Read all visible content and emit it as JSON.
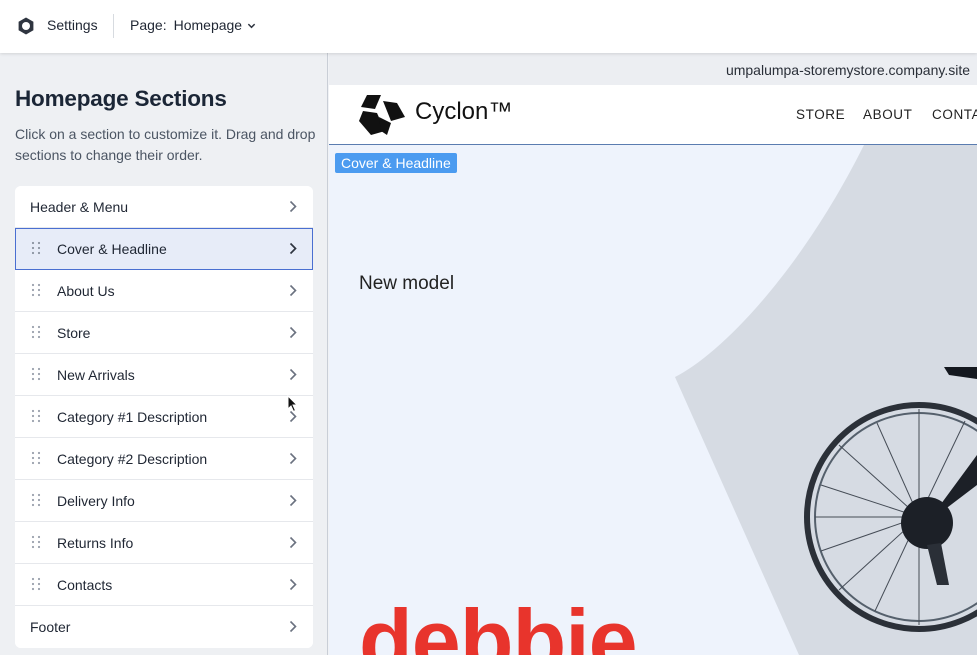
{
  "topbar": {
    "settings_label": "Settings",
    "page_label": "Page:",
    "page_value": "Homepage"
  },
  "sidebar": {
    "title": "Homepage Sections",
    "description": "Click on a section to customize it. Drag and drop sections to change their order.",
    "sections": [
      {
        "label": "Header & Menu"
      },
      {
        "label": "Cover & Headline",
        "selected": true
      },
      {
        "label": "About Us"
      },
      {
        "label": "Store"
      },
      {
        "label": "New Arrivals"
      },
      {
        "label": "Category #1 Description"
      },
      {
        "label": "Category #2 Description"
      },
      {
        "label": "Delivery Info"
      },
      {
        "label": "Returns Info"
      },
      {
        "label": "Contacts"
      },
      {
        "label": "Footer"
      }
    ]
  },
  "preview": {
    "url": "umpalumpa-storemystore.company.site",
    "brand": "Cyclon™",
    "nav": [
      "STORE",
      "ABOUT",
      "CONTA"
    ],
    "section_badge": "Cover & Headline",
    "cover_subtitle": "New model",
    "cover_word": "debbie"
  },
  "colors": {
    "accent": "#4b9bf0",
    "selected_border": "#4a6fd1",
    "headline_red": "#e8342c"
  }
}
